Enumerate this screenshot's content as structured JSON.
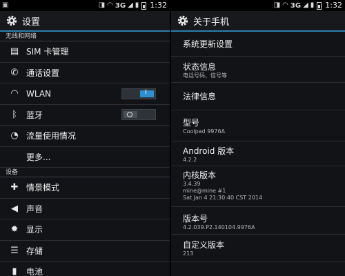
{
  "status": {
    "network": "3G",
    "time": "1:32"
  },
  "left": {
    "title": "设置",
    "section1": "无线和网络",
    "wireless_items": [
      {
        "label": "SIM 卡管理",
        "icon": "sim-card-icon"
      },
      {
        "label": "通话设置",
        "icon": "phone-icon"
      },
      {
        "label": "WLAN",
        "icon": "wifi-icon"
      },
      {
        "label": "蓝牙",
        "icon": "bluetooth-icon"
      },
      {
        "label": "流量使用情况",
        "icon": "data-usage-icon"
      },
      {
        "label": "更多..."
      }
    ],
    "wlan_toggle": "on",
    "bluetooth_toggle": "off",
    "section2": "设备",
    "device_items": [
      {
        "label": "情景模式",
        "icon": "profile-icon"
      },
      {
        "label": "声音",
        "icon": "speaker-icon"
      },
      {
        "label": "显示",
        "icon": "brightness-icon"
      },
      {
        "label": "存储",
        "icon": "storage-icon"
      },
      {
        "label": "电池",
        "icon": "battery-icon"
      }
    ]
  },
  "right": {
    "title": "关于手机",
    "items": [
      {
        "title": "系统更新设置"
      },
      {
        "title": "状态信息",
        "sub": [
          "电话号码、信号等"
        ]
      },
      {
        "title": "法律信息"
      },
      {
        "title": "型号",
        "sub": [
          "Coolpad 9976A"
        ]
      },
      {
        "title": "Android 版本",
        "sub": [
          "4.2.2"
        ]
      },
      {
        "title": "内核版本",
        "sub": [
          "3.4.39",
          "mine@mine #1",
          "Sat Jan 4 21:30:40 CST 2014"
        ]
      },
      {
        "title": "版本号",
        "sub": [
          "4.2.039.P2.140104.9976A"
        ]
      },
      {
        "title": "自定义版本",
        "sub": [
          "213"
        ]
      }
    ]
  },
  "accent_color": "#2a7fb0"
}
